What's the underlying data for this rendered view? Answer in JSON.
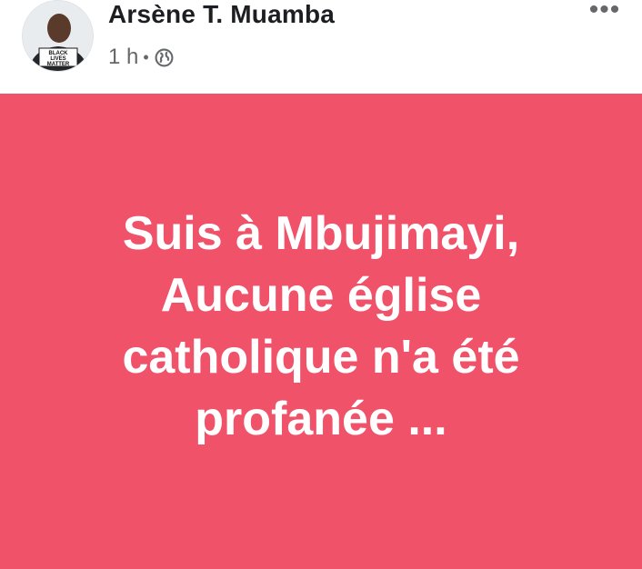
{
  "post": {
    "author_name": "Arsène T. Muamba",
    "timestamp": "1 h",
    "separator": "•",
    "audience_icon": "globe-icon",
    "more_options_label": "•••",
    "avatar_badge_lines": [
      "BLACK",
      "LIVES",
      "MATTER"
    ]
  },
  "status": {
    "background_color": "#f0526a",
    "text_color": "#ffffff",
    "lines": [
      "Suis à Mbujimayi,",
      "Aucune église",
      "catholique n'a été",
      "profanée ..."
    ]
  }
}
